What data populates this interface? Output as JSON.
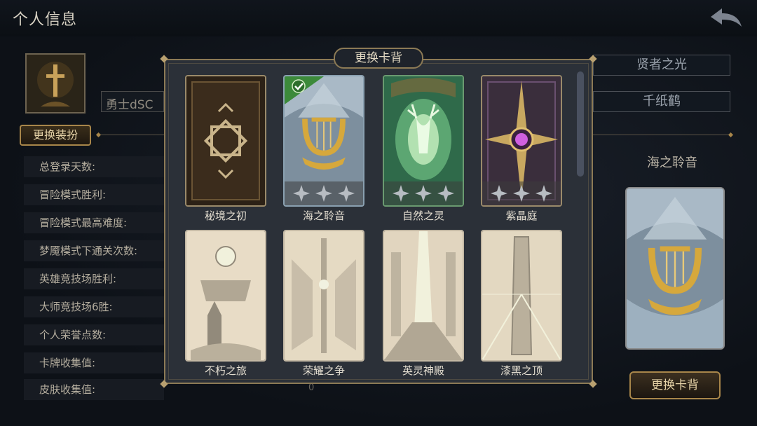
{
  "header": {
    "title": "个人信息"
  },
  "profile": {
    "player_name": "勇士dSC",
    "outfit_button": "更换装扮"
  },
  "stats": [
    {
      "label": "总登录天数:"
    },
    {
      "label": "冒险模式胜利:"
    },
    {
      "label": "冒险模式最高难度:"
    },
    {
      "label": "梦魇模式下通关次数:"
    },
    {
      "label": "英雄竞技场胜利:"
    },
    {
      "label": "大师竞技场6胜:"
    },
    {
      "label": "个人荣誉点数:"
    },
    {
      "label": "卡牌收集值:"
    },
    {
      "label": "皮肤收集值:",
      "value": "0"
    }
  ],
  "right_panel": {
    "title_value": "贤者之光",
    "badge_value": "千纸鹤",
    "current_card_back": "海之聆音",
    "change_button": "更换卡背"
  },
  "modal": {
    "title": "更换卡背",
    "cards": [
      {
        "name": "秘境之初",
        "selected": false,
        "stars": 0,
        "locked": false
      },
      {
        "name": "海之聆音",
        "selected": true,
        "stars": 3,
        "locked": false
      },
      {
        "name": "自然之灵",
        "selected": false,
        "stars": 3,
        "locked": false
      },
      {
        "name": "紫晶庭",
        "selected": false,
        "stars": 3,
        "locked": false
      },
      {
        "name": "不朽之旅",
        "selected": false,
        "stars": 0,
        "locked": true
      },
      {
        "name": "荣耀之争",
        "selected": false,
        "stars": 0,
        "locked": true
      },
      {
        "name": "英灵神殿",
        "selected": false,
        "stars": 0,
        "locked": true
      },
      {
        "name": "漆黑之顶",
        "selected": false,
        "stars": 0,
        "locked": true
      }
    ]
  },
  "colors": {
    "gold": "#a8864a",
    "panel": "#2b3038",
    "selected_check": "#3c8a3a"
  }
}
